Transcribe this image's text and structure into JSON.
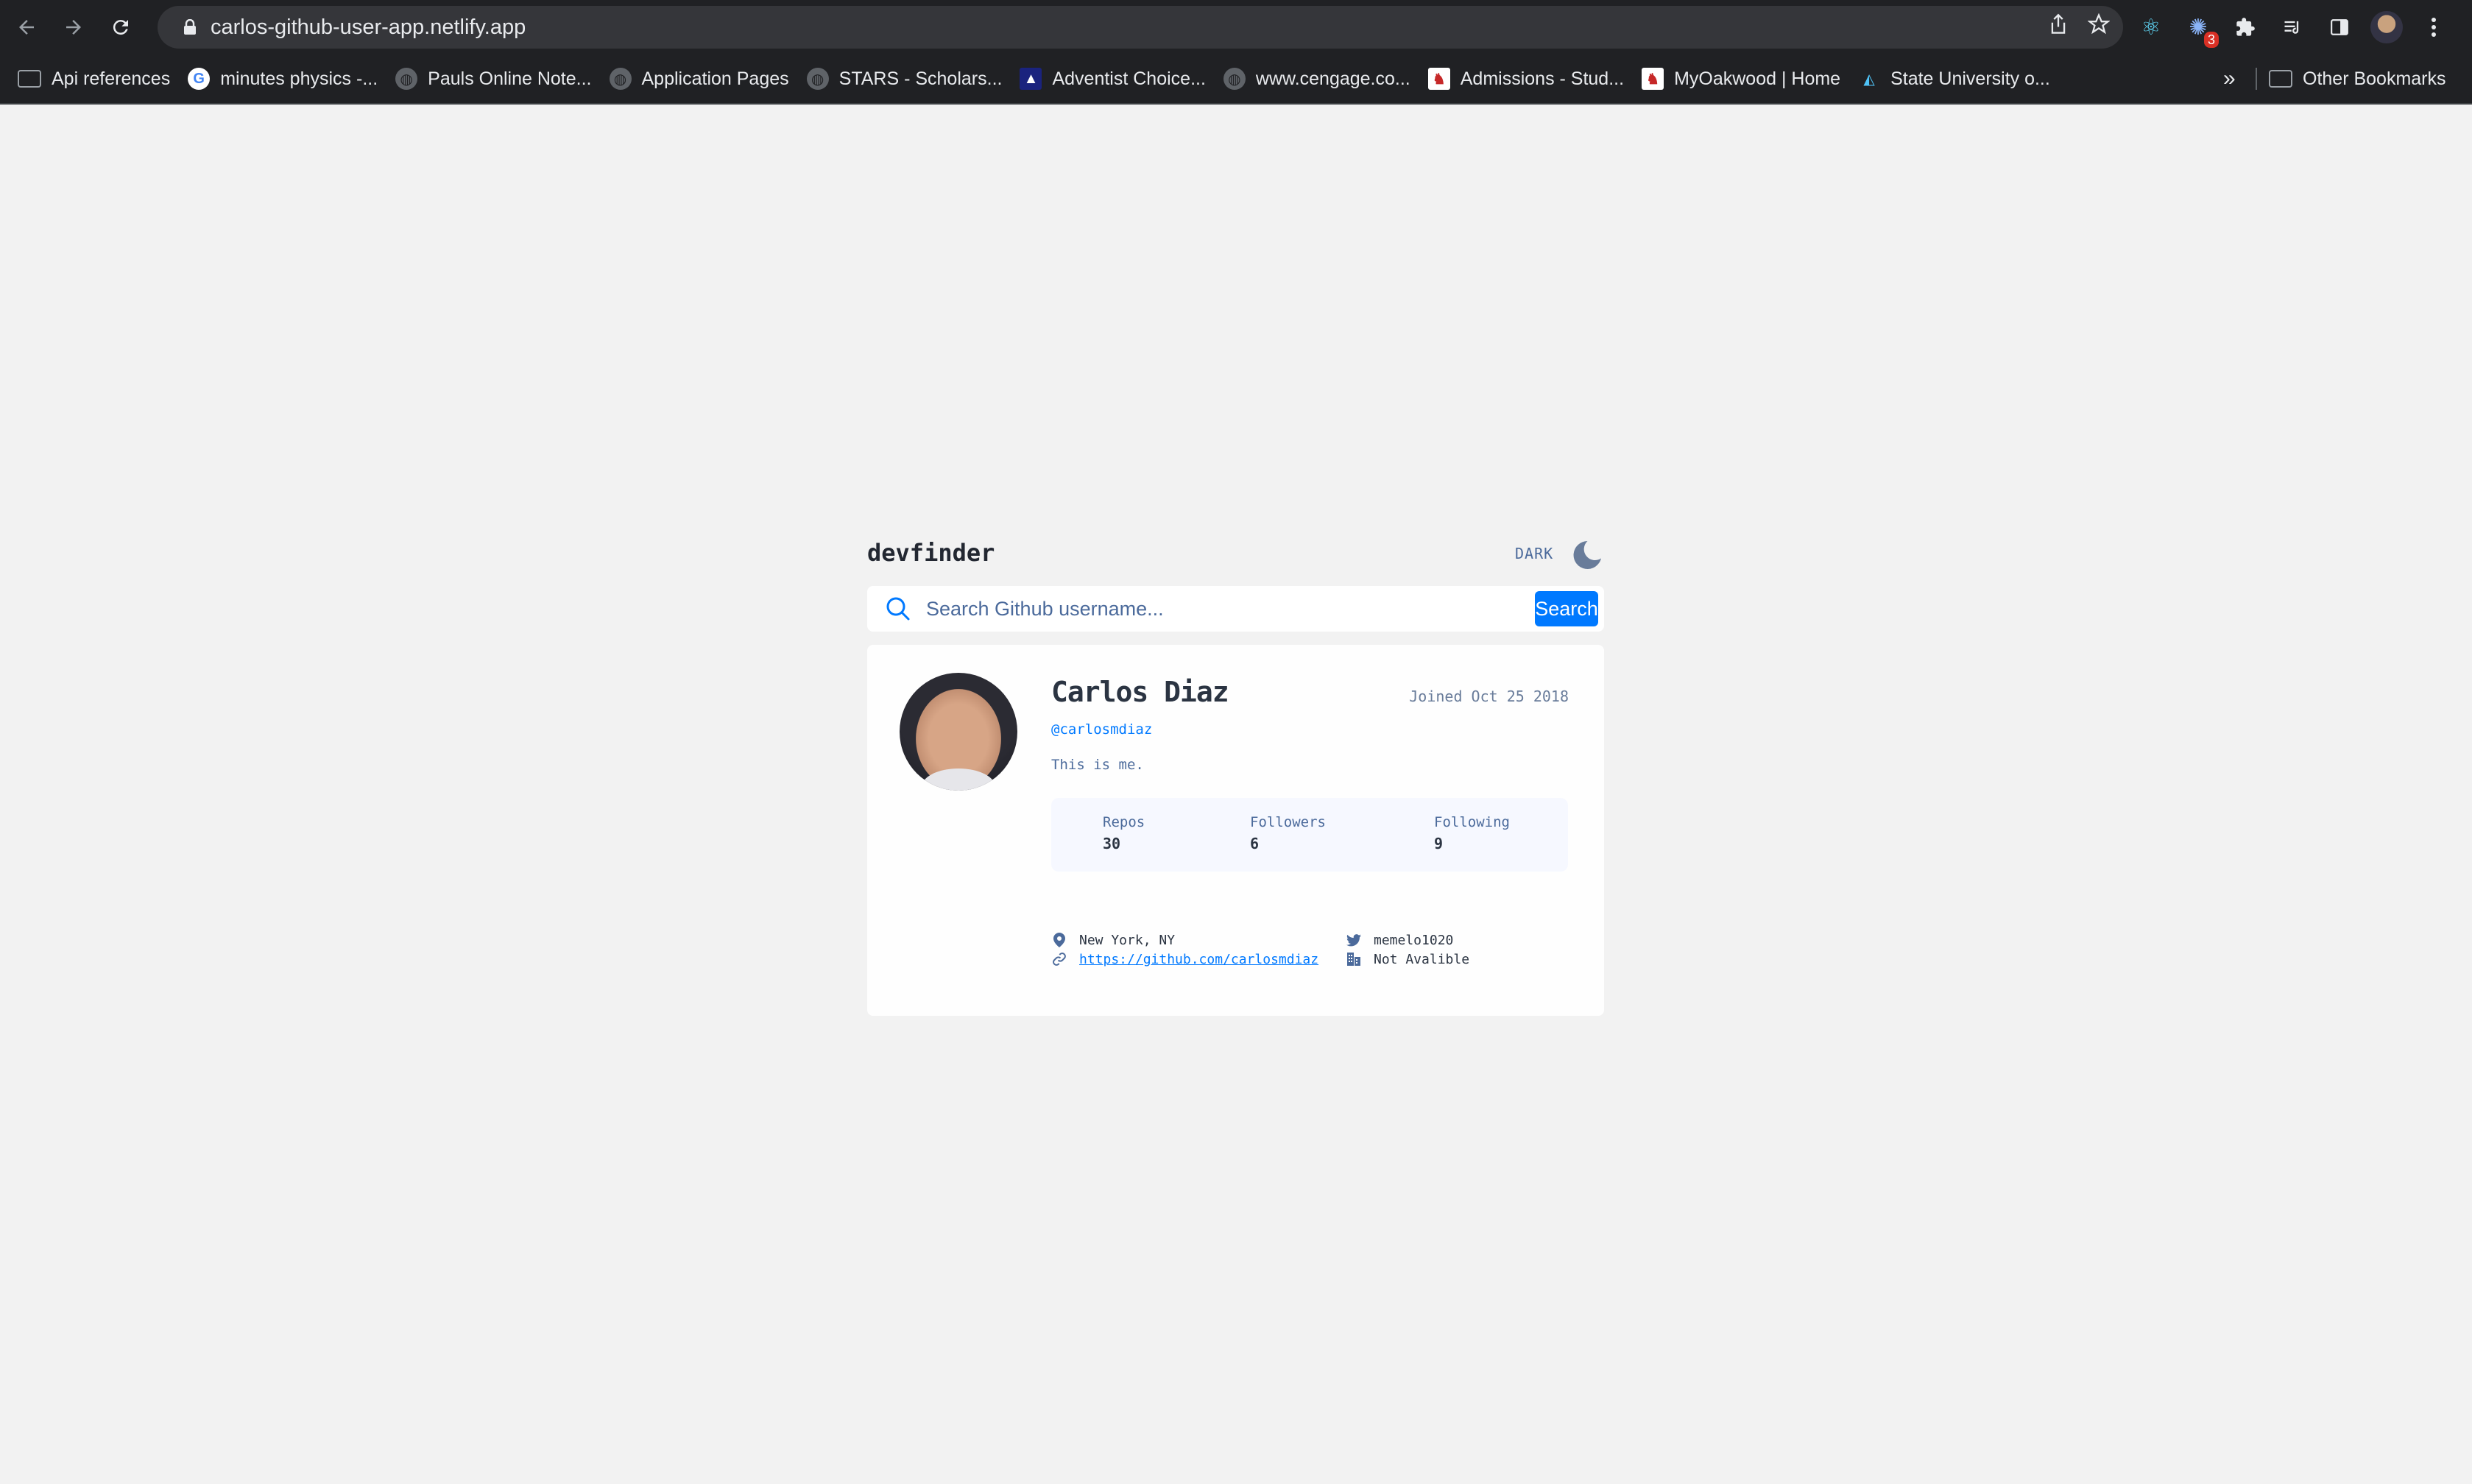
{
  "browser": {
    "url": "carlos-github-user-app.netlify.app",
    "extension_badge": "3",
    "bookmarks": [
      {
        "label": "Api references",
        "icon": "folder-icon"
      },
      {
        "label": "minutes physics -...",
        "icon": "google-icon"
      },
      {
        "label": "Pauls Online Note...",
        "icon": "globe-icon"
      },
      {
        "label": "Application Pages",
        "icon": "globe-icon"
      },
      {
        "label": "STARS - Scholars...",
        "icon": "globe-icon"
      },
      {
        "label": "Adventist Choice...",
        "icon": "adventist-icon"
      },
      {
        "label": "www.cengage.co...",
        "icon": "globe-icon"
      },
      {
        "label": "Admissions - Stud...",
        "icon": "oakwood-icon"
      },
      {
        "label": "MyOakwood | Home",
        "icon": "oakwood-icon"
      },
      {
        "label": "State University o...",
        "icon": "state-university-icon"
      }
    ],
    "more_bookmarks": "»",
    "other_bookmarks": "Other Bookmarks"
  },
  "app": {
    "logo": "devfinder",
    "theme_toggle_label": "DARK",
    "search": {
      "placeholder": "Search Github username...",
      "value": "",
      "button_label": "Search"
    },
    "profile": {
      "name": "Carlos Diaz",
      "joined": "Joined Oct 25 2018",
      "login": "@carlosmdiaz",
      "bio": "This is me.",
      "stats": {
        "repos_label": "Repos",
        "repos": "30",
        "followers_label": "Followers",
        "followers": "6",
        "following_label": "Following",
        "following": "9"
      },
      "location": "New York, NY",
      "blog": "https://github.com/carlosmdiaz",
      "twitter": "memelo1020",
      "company": "Not Avalible"
    }
  },
  "colors": {
    "accent": "#0079ff",
    "page_background": "#f2f2f2",
    "card_background": "#fefefe",
    "stats_background": "#f6f8ff",
    "text_secondary": "#4b6a9b"
  }
}
